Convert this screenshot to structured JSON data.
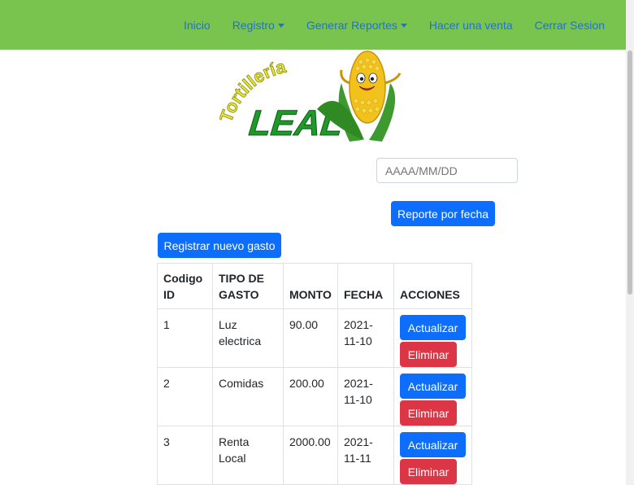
{
  "nav": {
    "items": [
      {
        "label": "Inicio",
        "dropdown": false
      },
      {
        "label": "Registro",
        "dropdown": true
      },
      {
        "label": "Generar Reportes",
        "dropdown": true
      },
      {
        "label": "Hacer una venta",
        "dropdown": false
      },
      {
        "label": "Cerrar Sesion",
        "dropdown": false
      }
    ]
  },
  "logo": {
    "line1": "Tortillería",
    "line2": "LEAL"
  },
  "filter": {
    "date_placeholder": "AAAA/MM/DD",
    "report_button": "Reporte por fecha"
  },
  "actions": {
    "new_expense": "Registrar nuevo gasto"
  },
  "table": {
    "headers": {
      "id": "Codigo ID",
      "tipo": "TIPO DE GASTO",
      "monto": "MONTO",
      "fecha": "FECHA",
      "acciones": "ACCIONES"
    },
    "rows": [
      {
        "id": "1",
        "tipo": "Luz electrica",
        "monto": "90.00",
        "fecha": "2021-11-10",
        "update": "Actualizar",
        "delete": "Eliminar"
      },
      {
        "id": "2",
        "tipo": "Comidas",
        "monto": "200.00",
        "fecha": "2021-11-10",
        "update": "Actualizar",
        "delete": "Eliminar"
      },
      {
        "id": "3",
        "tipo": "Renta Local",
        "monto": "2000.00",
        "fecha": "2021-11-11",
        "update": "Actualizar",
        "delete": "Eliminar"
      }
    ]
  },
  "colors": {
    "navbar": "#79c34f",
    "link": "#1e6fe6",
    "primary": "#0d6efd",
    "danger": "#dc3545"
  }
}
